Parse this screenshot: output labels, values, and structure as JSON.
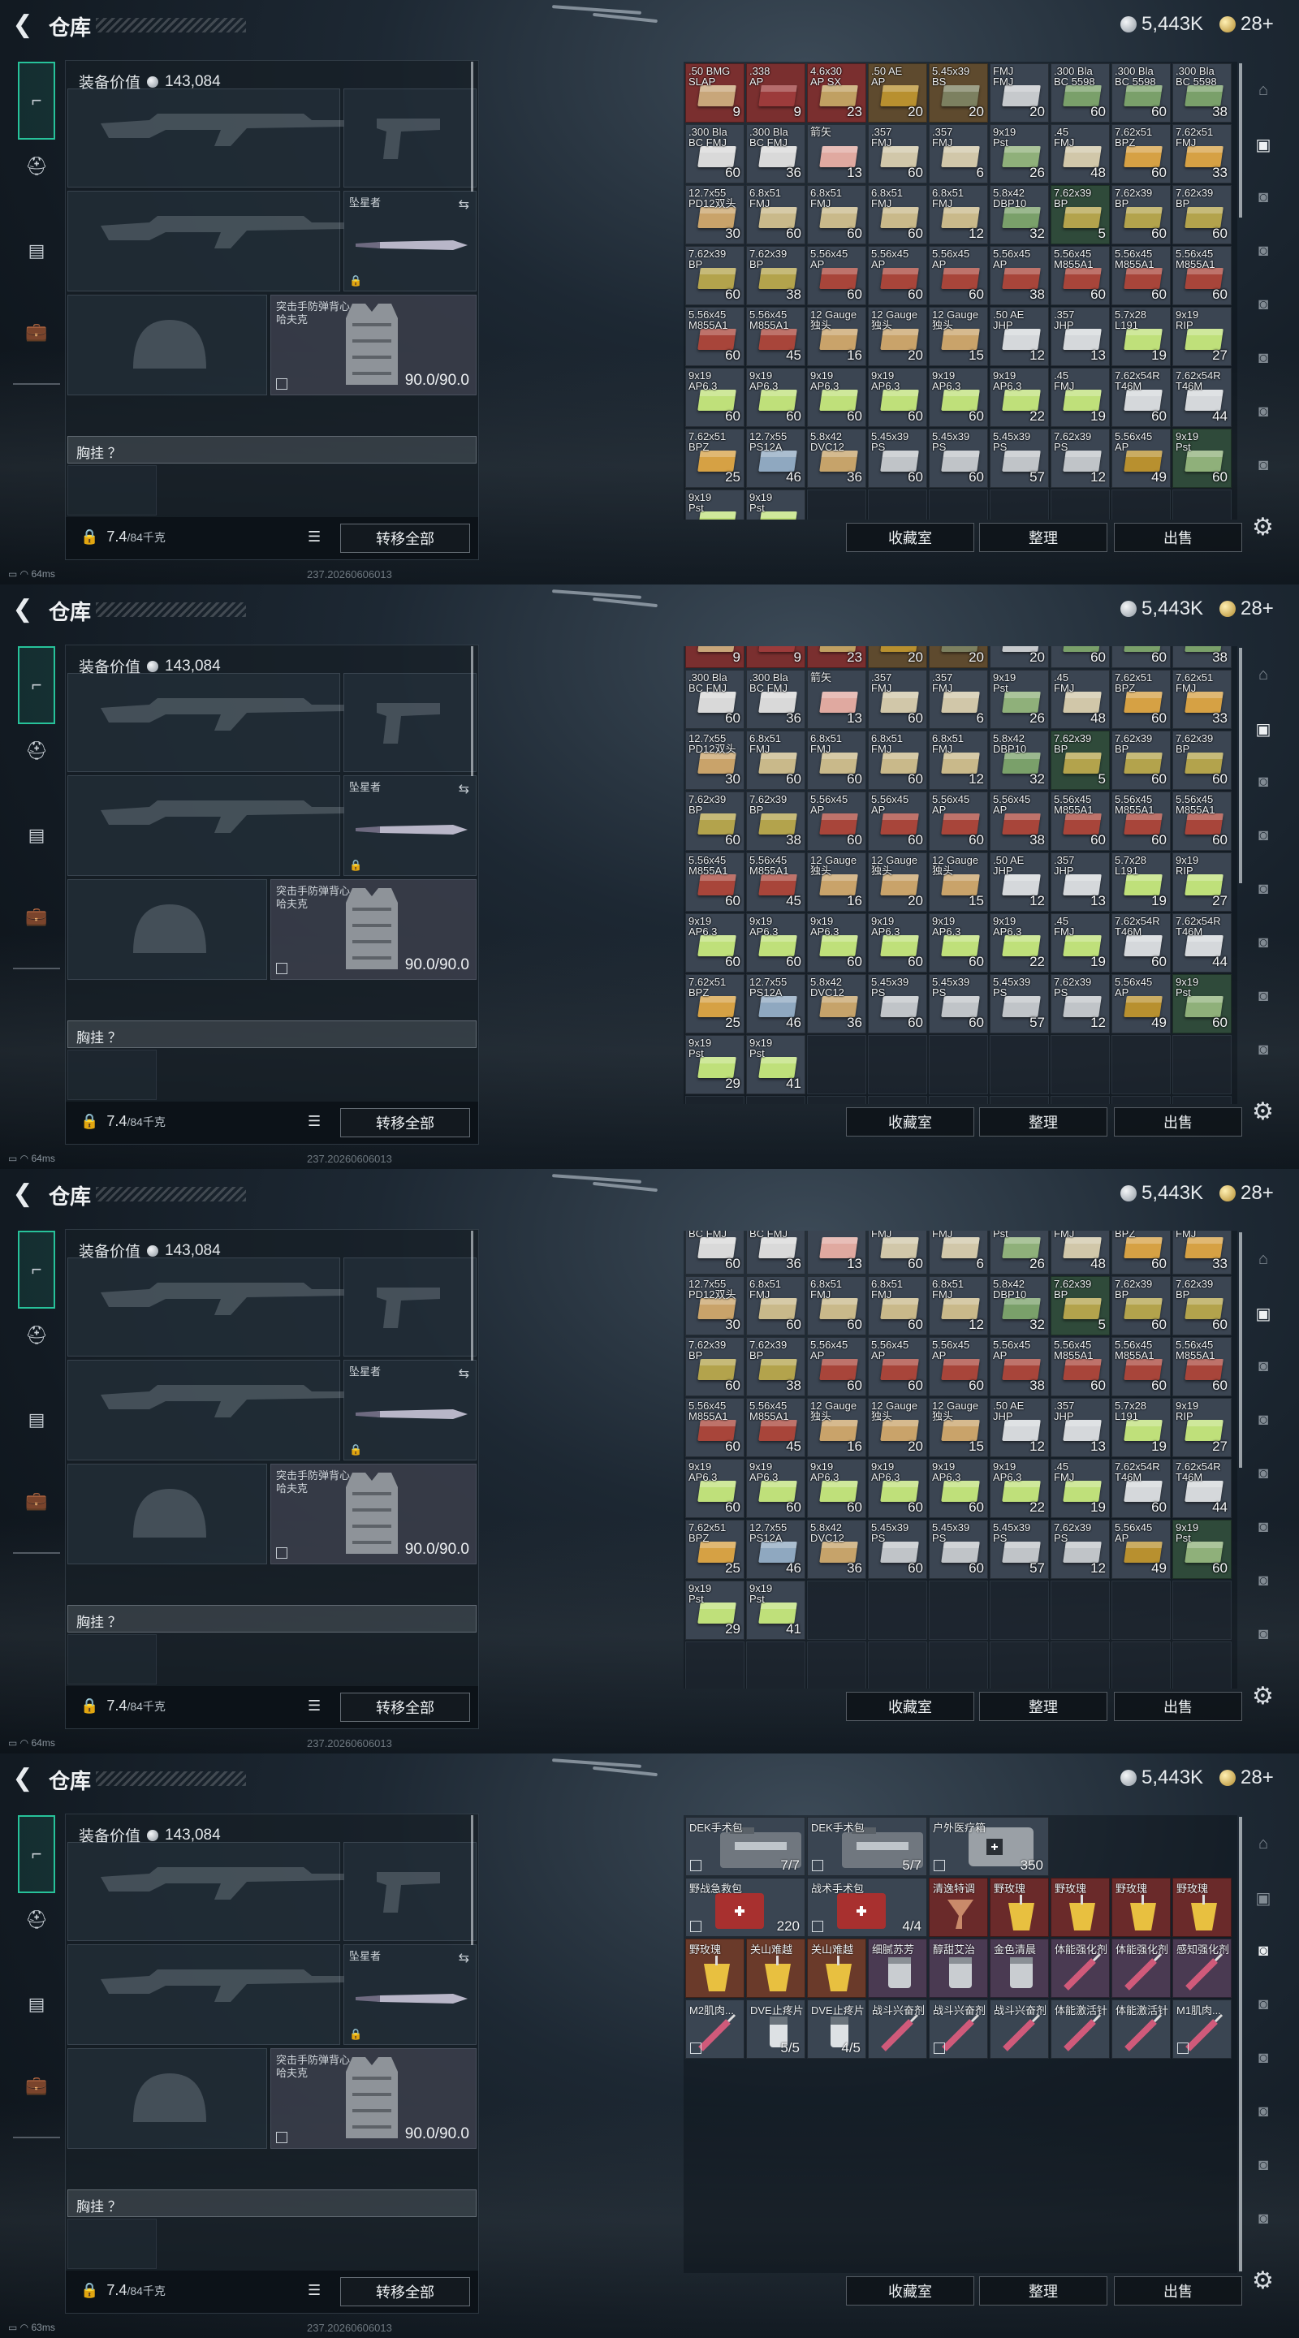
{
  "header": {
    "title": "仓库",
    "silver": "5,443K",
    "gold": "28+"
  },
  "loadout": {
    "equip_value_label": "装备价值",
    "equip_value": "143,084",
    "melee_name": "坠星者",
    "armor_name": "突击手防弹背心\n哈夫克",
    "armor_durability": "90.0/90.0",
    "chest_rig": "胸挂 ？",
    "weight": "7.4",
    "weight_cap": "/84千克",
    "transfer_all": "转移全部"
  },
  "footer": {
    "collection": "收藏室",
    "sort": "整理",
    "sell": "出售"
  },
  "status": {
    "ping_1": "64ms",
    "ping_4": "63ms",
    "build": "237.20260606013"
  },
  "colors": {
    "accent": "#27c29a"
  },
  "ammo_items": [
    {
      "n": ".50 BMG\nSLAP",
      "c": "9",
      "bg": "#7a2f2f",
      "bx": "#c8a67a"
    },
    {
      "n": ".338\nAP",
      "c": "9",
      "bg": "#7a2f2f",
      "bx": "#9c3b3b"
    },
    {
      "n": "4.6x30\nAP SX",
      "c": "23",
      "bg": "#7a2f2f",
      "bx": "#c0a062"
    },
    {
      "n": ".50 AE\nAP",
      "c": "20",
      "bg": "#5e4a2e",
      "bx": "#b8902f"
    },
    {
      "n": "5.45x39\nBS",
      "c": "20",
      "bg": "#5e4a2e",
      "bx": "#7c8060"
    },
    {
      "n": "FMJ\nFMJ",
      "c": "20",
      "bg": "#3b4552",
      "bx": "#c6c9cc"
    },
    {
      "n": ".300 Bla\nBC 5598",
      "c": "60",
      "bg": "#3b4552",
      "bx": "#7aa06a"
    },
    {
      "n": ".300 Bla\nBC 5598",
      "c": "60",
      "bg": "#3b4552",
      "bx": "#7aa06a"
    },
    {
      "n": ".300 Bla\nBC 5598",
      "c": "38",
      "bg": "#3b4552",
      "bx": "#7aa06a"
    },
    {
      "n": ".300 Bla\nBC FMJ",
      "c": "60",
      "bg": "#3b4552",
      "bx": "#d9d9d9"
    },
    {
      "n": ".300 Bla\nBC FMJ",
      "c": "36",
      "bg": "#3b4552",
      "bx": "#d9d9d9"
    },
    {
      "n": "箭矢",
      "c": "13",
      "bg": "#3b4552",
      "bx": "#e0a9a0"
    },
    {
      "n": ".357\nFMJ",
      "c": "60",
      "bg": "#3b4552",
      "bx": "#d1c7a9"
    },
    {
      "n": ".357\nFMJ",
      "c": "6",
      "bg": "#3b4552",
      "bx": "#d1c7a9"
    },
    {
      "n": "9x19\nPst",
      "c": "26",
      "bg": "#3b4552",
      "bx": "#8fb07a"
    },
    {
      "n": ".45\nFMJ",
      "c": "48",
      "bg": "#3b4552",
      "bx": "#d1c7a9"
    },
    {
      "n": "7.62x51\nBPZ",
      "c": "60",
      "bg": "#3b4552",
      "bx": "#d6a144"
    },
    {
      "n": "7.62x51\nFMJ",
      "c": "33",
      "bg": "#3b4552",
      "bx": "#d6a144"
    },
    {
      "n": "12.7x55\nPD12双头",
      "c": "30",
      "bg": "#3b4552",
      "bx": "#c9a36a"
    },
    {
      "n": "6.8x51\nFMJ",
      "c": "60",
      "bg": "#3b4552",
      "bx": "#c9b98a"
    },
    {
      "n": "6.8x51\nFMJ",
      "c": "60",
      "bg": "#3b4552",
      "bx": "#c9b98a"
    },
    {
      "n": "6.8x51\nFMJ",
      "c": "60",
      "bg": "#3b4552",
      "bx": "#c9b98a"
    },
    {
      "n": "6.8x51\nFMJ",
      "c": "12",
      "bg": "#3b4552",
      "bx": "#c9b98a"
    },
    {
      "n": "5.8x42\nDBP10",
      "c": "32",
      "bg": "#3b4552",
      "bx": "#7aa06a"
    },
    {
      "n": "7.62x39\nBP",
      "c": "5",
      "bg": "#2f4a3a",
      "bx": "#b3a34c"
    },
    {
      "n": "7.62x39\nBP",
      "c": "60",
      "bg": "#3b4552",
      "bx": "#b3a34c"
    },
    {
      "n": "7.62x39\nBP",
      "c": "60",
      "bg": "#3b4552",
      "bx": "#b3a34c"
    },
    {
      "n": "7.62x39\nBP",
      "c": "60",
      "bg": "#3b4552",
      "bx": "#b3a34c"
    },
    {
      "n": "7.62x39\nBP",
      "c": "38",
      "bg": "#3b4552",
      "bx": "#b3a34c"
    },
    {
      "n": "5.56x45\nAP",
      "c": "60",
      "bg": "#3b4552",
      "bx": "#a8453a"
    },
    {
      "n": "5.56x45\nAP",
      "c": "60",
      "bg": "#3b4552",
      "bx": "#a8453a"
    },
    {
      "n": "5.56x45\nAP",
      "c": "60",
      "bg": "#3b4552",
      "bx": "#a8453a"
    },
    {
      "n": "5.56x45\nAP",
      "c": "38",
      "bg": "#3b4552",
      "bx": "#a8453a"
    },
    {
      "n": "5.56x45\nM855A1",
      "c": "60",
      "bg": "#3b4552",
      "bx": "#a8453a"
    },
    {
      "n": "5.56x45\nM855A1",
      "c": "60",
      "bg": "#3b4552",
      "bx": "#a8453a"
    },
    {
      "n": "5.56x45\nM855A1",
      "c": "60",
      "bg": "#3b4552",
      "bx": "#a8453a"
    },
    {
      "n": "5.56x45\nM855A1",
      "c": "60",
      "bg": "#3b4552",
      "bx": "#a8453a"
    },
    {
      "n": "5.56x45\nM855A1",
      "c": "45",
      "bg": "#3b4552",
      "bx": "#a8453a"
    },
    {
      "n": "12 Gauge\n独头",
      "c": "16",
      "bg": "#3b4552",
      "bx": "#c9a36a"
    },
    {
      "n": "12 Gauge\n独头",
      "c": "20",
      "bg": "#3b4552",
      "bx": "#c9a36a"
    },
    {
      "n": "12 Gauge\n独头",
      "c": "15",
      "bg": "#3b4552",
      "bx": "#c9a36a"
    },
    {
      "n": ".50 AE\nJHP",
      "c": "12",
      "bg": "#3b4552",
      "bx": "#d5d8db"
    },
    {
      "n": ".357\nJHP",
      "c": "13",
      "bg": "#3b4552",
      "bx": "#d5d8db"
    },
    {
      "n": "5.7x28\nL191",
      "c": "19",
      "bg": "#3b4552",
      "bx": "#bfe07a"
    },
    {
      "n": "9x19\nRIP",
      "c": "27",
      "bg": "#3b4552",
      "bx": "#bfe07a"
    },
    {
      "n": "9x19\nAP6.3",
      "c": "60",
      "bg": "#3b4552",
      "bx": "#bfe07a"
    },
    {
      "n": "9x19\nAP6.3",
      "c": "60",
      "bg": "#3b4552",
      "bx": "#bfe07a"
    },
    {
      "n": "9x19\nAP6.3",
      "c": "60",
      "bg": "#3b4552",
      "bx": "#bfe07a"
    },
    {
      "n": "9x19\nAP6.3",
      "c": "60",
      "bg": "#3b4552",
      "bx": "#bfe07a"
    },
    {
      "n": "9x19\nAP6.3",
      "c": "60",
      "bg": "#3b4552",
      "bx": "#bfe07a"
    },
    {
      "n": "9x19\nAP6.3",
      "c": "22",
      "bg": "#3b4552",
      "bx": "#bfe07a"
    },
    {
      "n": ".45\nFMJ",
      "c": "19",
      "bg": "#3b4552",
      "bx": "#bfe07a"
    },
    {
      "n": "7.62x54R\nT46M",
      "c": "60",
      "bg": "#3b4552",
      "bx": "#d5d8db"
    },
    {
      "n": "7.62x54R\nT46M",
      "c": "44",
      "bg": "#3b4552",
      "bx": "#d5d8db"
    },
    {
      "n": "7.62x51\nBPZ",
      "c": "25",
      "bg": "#3b4552",
      "bx": "#d6a144"
    },
    {
      "n": "12.7x55\nPS12A",
      "c": "46",
      "bg": "#3b4552",
      "bx": "#8fa8c0"
    },
    {
      "n": "5.8x42\nDVC12",
      "c": "36",
      "bg": "#3b4552",
      "bx": "#c6a36a"
    },
    {
      "n": "5.45x39\nPS",
      "c": "60",
      "bg": "#3b4552",
      "bx": "#c0c4c8"
    },
    {
      "n": "5.45x39\nPS",
      "c": "60",
      "bg": "#3b4552",
      "bx": "#c0c4c8"
    },
    {
      "n": "5.45x39\nPS",
      "c": "57",
      "bg": "#3b4552",
      "bx": "#c0c4c8"
    },
    {
      "n": "7.62x39\nPS",
      "c": "12",
      "bg": "#3b4552",
      "bx": "#c0c4c8"
    },
    {
      "n": "5.56x45\nAP",
      "c": "49",
      "bg": "#3b4552",
      "bx": "#b8902f"
    },
    {
      "n": "9x19\nPst",
      "c": "60",
      "bg": "#2f4a3a",
      "bx": "#8fb07a"
    },
    {
      "n": "9x19\nPst",
      "c": "29",
      "bg": "#3b4552",
      "bx": "#bfe07a"
    },
    {
      "n": "9x19\nPst",
      "c": "41",
      "bg": "#3b4552",
      "bx": "#bfe07a"
    }
  ],
  "med_items": [
    {
      "n": "DEK手术包",
      "c": "7/7",
      "col": 0,
      "row": 0,
      "w": 2,
      "h": 1,
      "bg": "#3a4552",
      "kind": "case"
    },
    {
      "n": "DEK手术包",
      "c": "5/7",
      "col": 2,
      "row": 0,
      "w": 2,
      "h": 1,
      "bg": "#3a4552",
      "kind": "case"
    },
    {
      "n": "户外医疗箱",
      "c": "350",
      "col": 4,
      "row": 0,
      "w": 2,
      "h": 1,
      "bg": "#3a4552",
      "kind": "bag"
    },
    {
      "n": "野战急救包",
      "c": "220",
      "col": 0,
      "row": 1,
      "w": 2,
      "h": 1,
      "bg": "#3a4552",
      "kind": "red"
    },
    {
      "n": "战术手术包",
      "c": "4/4",
      "col": 2,
      "row": 1,
      "w": 2,
      "h": 1,
      "bg": "#3a4552",
      "kind": "red"
    },
    {
      "n": "清逸特调",
      "c": "",
      "col": 4,
      "row": 1,
      "w": 1,
      "h": 1,
      "bg": "#6a2a2a",
      "kind": "glass"
    },
    {
      "n": "野玫瑰",
      "c": "",
      "col": 5,
      "row": 1,
      "w": 1,
      "h": 1,
      "bg": "#6a2a2a",
      "kind": "drink"
    },
    {
      "n": "野玫瑰",
      "c": "",
      "col": 6,
      "row": 1,
      "w": 1,
      "h": 1,
      "bg": "#6a2a2a",
      "kind": "drink"
    },
    {
      "n": "野玫瑰",
      "c": "",
      "col": 7,
      "row": 1,
      "w": 1,
      "h": 1,
      "bg": "#6a2a2a",
      "kind": "drink"
    },
    {
      "n": "野玫瑰",
      "c": "",
      "col": 8,
      "row": 1,
      "w": 1,
      "h": 1,
      "bg": "#6a2a2a",
      "kind": "drink"
    },
    {
      "n": "野玫瑰",
      "c": "",
      "col": 0,
      "row": 2,
      "w": 1,
      "h": 1,
      "bg": "#6a3a2a",
      "kind": "drink"
    },
    {
      "n": "关山难越",
      "c": "",
      "col": 1,
      "row": 2,
      "w": 1,
      "h": 1,
      "bg": "#6a3a2a",
      "kind": "drink"
    },
    {
      "n": "关山难越",
      "c": "",
      "col": 2,
      "row": 2,
      "w": 1,
      "h": 1,
      "bg": "#6a3a2a",
      "kind": "drink"
    },
    {
      "n": "细腻苏芳",
      "c": "",
      "col": 3,
      "row": 2,
      "w": 1,
      "h": 1,
      "bg": "#4a3a52",
      "kind": "jar"
    },
    {
      "n": "醇甜艾治",
      "c": "",
      "col": 4,
      "row": 2,
      "w": 1,
      "h": 1,
      "bg": "#4a3a52",
      "kind": "jar"
    },
    {
      "n": "金色清晨",
      "c": "",
      "col": 5,
      "row": 2,
      "w": 1,
      "h": 1,
      "bg": "#4a3a52",
      "kind": "jar"
    },
    {
      "n": "体能强化剂",
      "c": "",
      "col": 6,
      "row": 2,
      "w": 1,
      "h": 1,
      "bg": "#4a3a52",
      "kind": "syringe"
    },
    {
      "n": "体能强化剂",
      "c": "",
      "col": 7,
      "row": 2,
      "w": 1,
      "h": 1,
      "bg": "#4a3a52",
      "kind": "syringe"
    },
    {
      "n": "感知强化剂",
      "c": "",
      "col": 8,
      "row": 2,
      "w": 1,
      "h": 1,
      "bg": "#4a3a52",
      "kind": "syringe"
    },
    {
      "n": "M2肌肉...",
      "c": "",
      "col": 0,
      "row": 3,
      "w": 1,
      "h": 1,
      "bg": "#3a4552",
      "kind": "syringe"
    },
    {
      "n": "DVE止疼片",
      "c": "5/5",
      "col": 1,
      "row": 3,
      "w": 1,
      "h": 1,
      "bg": "#3a4552",
      "kind": "pills"
    },
    {
      "n": "DVE止疼片",
      "c": "4/5",
      "col": 2,
      "row": 3,
      "w": 1,
      "h": 1,
      "bg": "#3a4552",
      "kind": "pills"
    },
    {
      "n": "战斗兴奋剂",
      "c": "",
      "col": 3,
      "row": 3,
      "w": 1,
      "h": 1,
      "bg": "#3a4552",
      "kind": "syringe"
    },
    {
      "n": "战斗兴奋剂",
      "c": "",
      "col": 4,
      "row": 3,
      "w": 1,
      "h": 1,
      "bg": "#3a4552",
      "kind": "syringe"
    },
    {
      "n": "战斗兴奋剂",
      "c": "",
      "col": 5,
      "row": 3,
      "w": 1,
      "h": 1,
      "bg": "#3a4552",
      "kind": "syringe"
    },
    {
      "n": "体能激活针",
      "c": "",
      "col": 6,
      "row": 3,
      "w": 1,
      "h": 1,
      "bg": "#3a4552",
      "kind": "syringe"
    },
    {
      "n": "体能激活针",
      "c": "",
      "col": 7,
      "row": 3,
      "w": 1,
      "h": 1,
      "bg": "#3a4552",
      "kind": "syringe"
    },
    {
      "n": "M1肌肉...",
      "c": "",
      "col": 8,
      "row": 3,
      "w": 1,
      "h": 1,
      "bg": "#3a4552",
      "kind": "syringe"
    }
  ]
}
